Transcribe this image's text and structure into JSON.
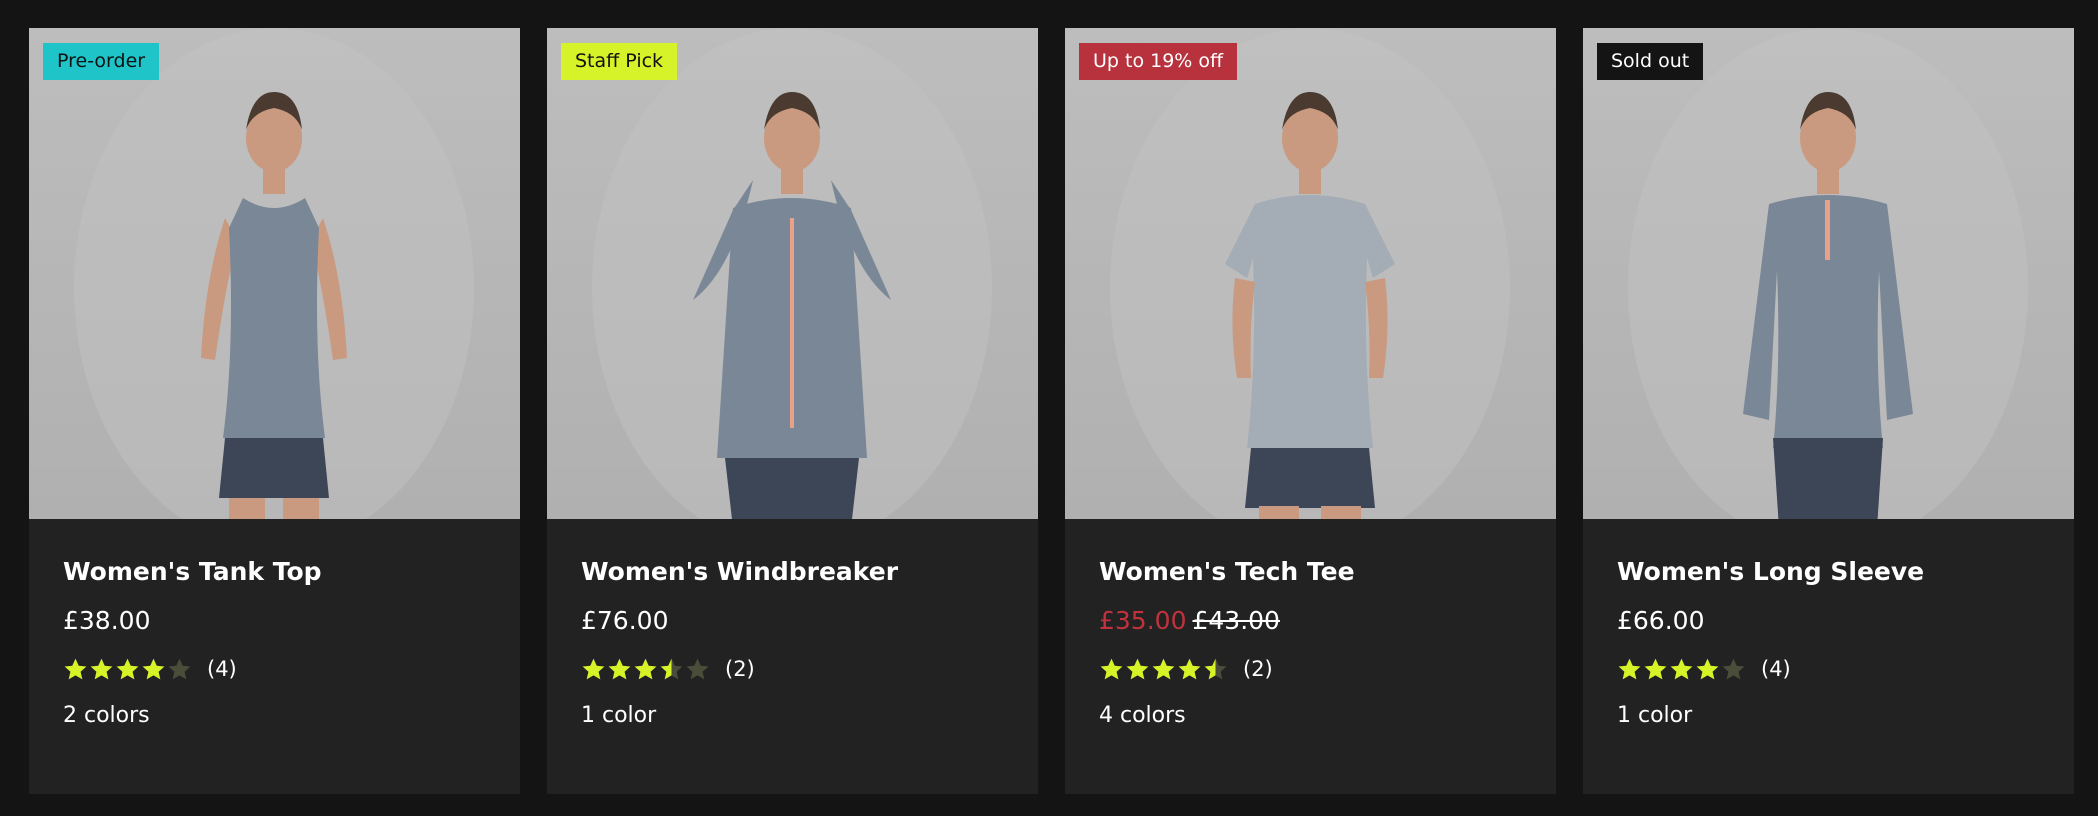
{
  "theme": {
    "accent_star": "#d6f228",
    "sale_color": "#c1323d"
  },
  "products": [
    {
      "badge": "Pre-order",
      "badge_color": "#1ec4c8",
      "badge_text_color": "#111111",
      "name": "Women's Tank Top",
      "price": "£38.00",
      "sale_price": "",
      "was_price": "",
      "rating": 4.0,
      "review_count": "(4)",
      "colors": "2 colors",
      "garment": "tank"
    },
    {
      "badge": "Staff Pick",
      "badge_color": "#d6f228",
      "badge_text_color": "#111111",
      "name": "Women's Windbreaker",
      "price": "£76.00",
      "sale_price": "",
      "was_price": "",
      "rating": 3.5,
      "review_count": "(2)",
      "colors": "1 color",
      "garment": "jacket"
    },
    {
      "badge": "Up to 19% off",
      "badge_color": "#b8323d",
      "badge_text_color": "#ffffff",
      "name": "Women's Tech Tee",
      "price": "",
      "sale_price": "£35.00",
      "was_price": "£43.00",
      "rating": 4.5,
      "review_count": "(2)",
      "colors": "4 colors",
      "garment": "tee"
    },
    {
      "badge": "Sold out",
      "badge_color": "#141414",
      "badge_text_color": "#ffffff",
      "name": "Women's Long Sleeve",
      "price": "£66.00",
      "sale_price": "",
      "was_price": "",
      "rating": 4.0,
      "review_count": "(4)",
      "colors": "1 color",
      "garment": "longsleeve"
    }
  ]
}
